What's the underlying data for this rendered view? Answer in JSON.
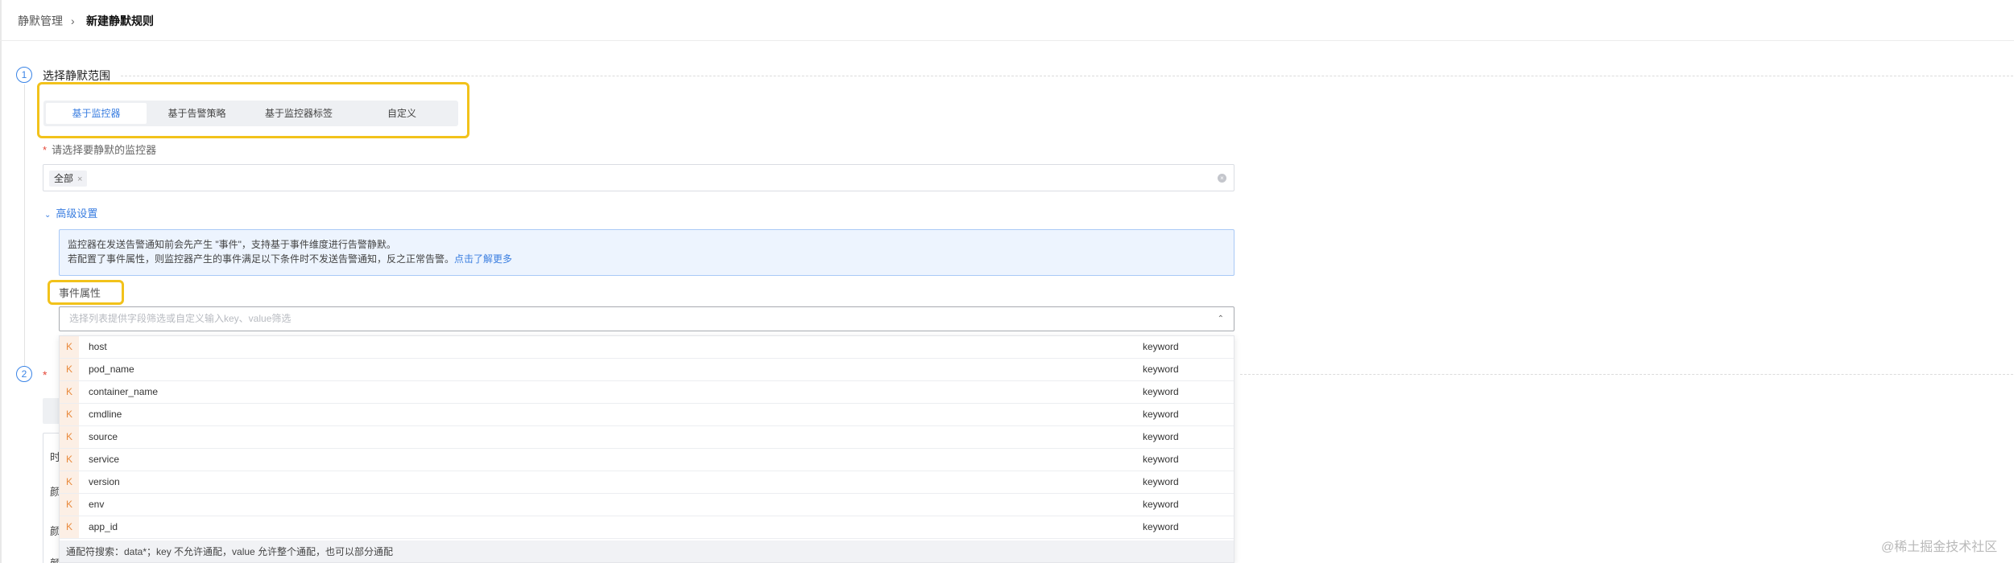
{
  "breadcrumb": {
    "parent": "静默管理",
    "separator": "›",
    "current": "新建静默规则"
  },
  "step1": {
    "number": "1",
    "title": "选择静默范围",
    "tabs": [
      {
        "label": "基于监控器",
        "active": true
      },
      {
        "label": "基于告警策略",
        "active": false
      },
      {
        "label": "基于监控器标签",
        "active": false
      },
      {
        "label": "自定义",
        "active": false
      }
    ],
    "monitor_field": {
      "required": "*",
      "label": "请选择要静默的监控器",
      "tag": "全部",
      "tag_remove": "×",
      "clear_icon": "×"
    },
    "advanced": {
      "chevron": "⌄",
      "label": "高级设置"
    },
    "info": {
      "line1": "监控器在发送告警通知前会先产生 \"事件\"，支持基于事件维度进行告警静默。",
      "line2": "若配置了事件属性，则监控器产生的事件满足以下条件时不发送告警通知，反之正常告警。",
      "link": "点击了解更多"
    },
    "event_attr": {
      "label": "事件属性",
      "placeholder": "选择列表提供字段筛选或自定义输入key、value筛选",
      "chevron": "⌃"
    }
  },
  "dropdown": {
    "kind_badge": "K",
    "items": [
      {
        "name": "host",
        "type": "keyword"
      },
      {
        "name": "pod_name",
        "type": "keyword"
      },
      {
        "name": "container_name",
        "type": "keyword"
      },
      {
        "name": "cmdline",
        "type": "keyword"
      },
      {
        "name": "source",
        "type": "keyword"
      },
      {
        "name": "service",
        "type": "keyword"
      },
      {
        "name": "version",
        "type": "keyword"
      },
      {
        "name": "env",
        "type": "keyword"
      },
      {
        "name": "app_id",
        "type": "keyword"
      }
    ],
    "footer": "通配符搜索：data*；key 不允许通配，value 允许整个通配，也可以部分通配"
  },
  "step2": {
    "number": "2",
    "title_partial": "*",
    "labels": [
      "时",
      "颜",
      "颜",
      "颜"
    ]
  },
  "watermark": "@稀土掘金技术社区",
  "colors": {
    "accent": "#3a7ee0",
    "highlight": "#f2c21b",
    "info_bg": "#edf4fe",
    "keyword_badge": "#e98a3c"
  }
}
